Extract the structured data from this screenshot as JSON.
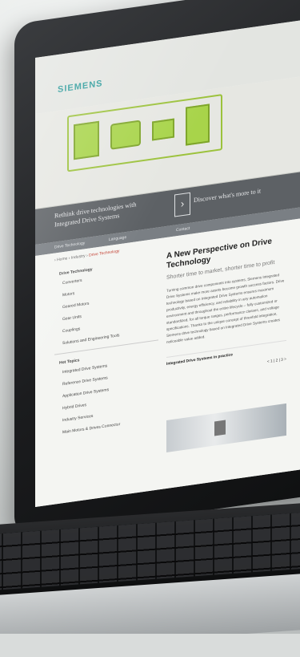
{
  "header": {
    "logo": "SIEMENS"
  },
  "banner": {
    "headline": "Rethink drive technologies with Integrated Drive Systems",
    "button_icon": "chevron-right-icon",
    "cta": "Discover what's more to it"
  },
  "navbar": {
    "left": "Drive Technology",
    "middle": "Language",
    "right": "Contact"
  },
  "breadcrumb": [
    "Home",
    "Industry",
    "Drive Technology"
  ],
  "sidenav": {
    "title": "Drive Technology",
    "items": [
      "Converters",
      "Motors",
      "Geared Motors",
      "Gear Units",
      "Couplings",
      "Solutions and Engineering Tools"
    ],
    "hot_title": "Hot Topics",
    "hot_items": [
      "Integrated Drive Systems",
      "Reference Drive Systems",
      "Application Drive Systems",
      "Hybrid Drives",
      "Industry Services",
      "Main Motors & Drives Connector"
    ]
  },
  "article": {
    "title": "A New Perspective on Drive Technology",
    "subtitle": "Shorter time to market, shorter time to profit",
    "body": "Turning common drive components into systems, Siemens Integrated Drive Systems make more assets become growth success factors. Drive technology based on Integrated Drive Systems ensures maximum productivity, energy efficiency, and reliability in any automation environment and throughout the entire lifecycle – fully customized or standardized, for all torque ranges, performance classes, and voltage specifications. Thanks to the unique concept of threefold integration, Siemens drive technology based on Integrated Drive Systems creates noticeable value added.",
    "practice": "Integrated Drive Systems in practice",
    "pager": "< 1 | 2 | 3 >"
  }
}
